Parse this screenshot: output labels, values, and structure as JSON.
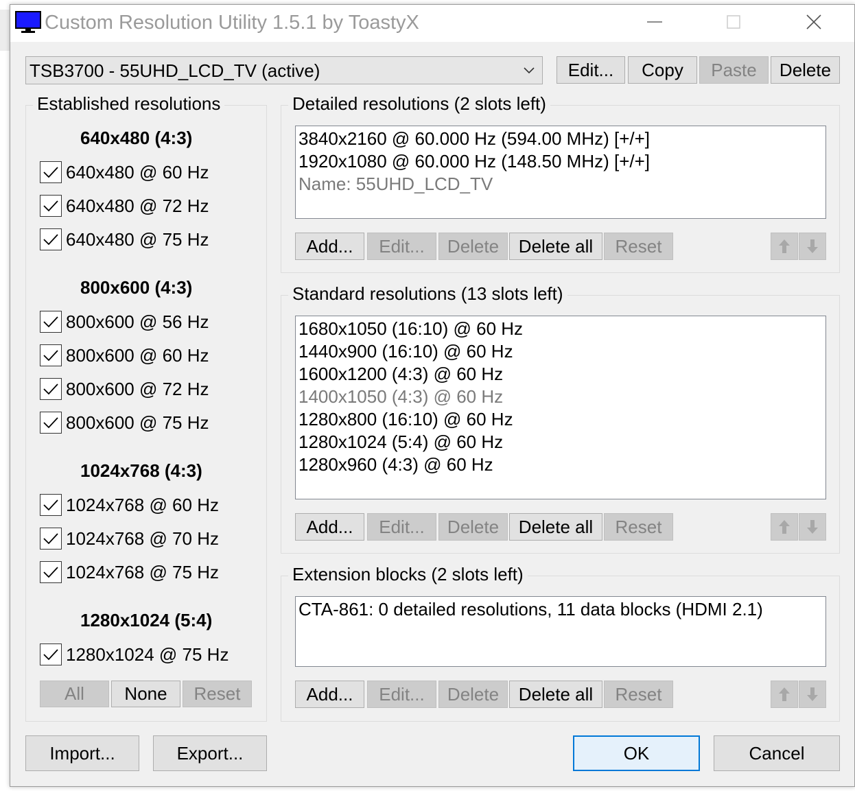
{
  "window": {
    "title": "Custom Resolution Utility 1.5.1 by ToastyX"
  },
  "display": {
    "selected": "TSB3700 - 55UHD_LCD_TV (active)"
  },
  "top_buttons": {
    "edit": "Edit...",
    "copy": "Copy",
    "paste": "Paste",
    "delete": "Delete"
  },
  "established": {
    "title": "Established resolutions",
    "groups": [
      {
        "heading": "640x480 (4:3)",
        "items": [
          "640x480 @ 60 Hz",
          "640x480 @ 72 Hz",
          "640x480 @ 75 Hz"
        ]
      },
      {
        "heading": "800x600 (4:3)",
        "items": [
          "800x600 @ 56 Hz",
          "800x600 @ 60 Hz",
          "800x600 @ 72 Hz",
          "800x600 @ 75 Hz"
        ]
      },
      {
        "heading": "1024x768 (4:3)",
        "items": [
          "1024x768 @ 60 Hz",
          "1024x768 @ 70 Hz",
          "1024x768 @ 75 Hz"
        ]
      },
      {
        "heading": "1280x1024 (5:4)",
        "items": [
          "1280x1024 @ 75 Hz"
        ]
      }
    ],
    "buttons": {
      "all": "All",
      "none": "None",
      "reset": "Reset"
    }
  },
  "detailed": {
    "title": "Detailed resolutions (2 slots left)",
    "items": [
      "3840x2160 @ 60.000 Hz (594.00 MHz) [+/+]",
      "1920x1080 @ 60.000 Hz (148.50 MHz) [+/+]",
      "Name: 55UHD_LCD_TV"
    ]
  },
  "standard": {
    "title": "Standard resolutions (13 slots left)",
    "items": [
      "1680x1050 (16:10) @ 60 Hz",
      "1440x900 (16:10) @ 60 Hz",
      "1600x1200 (4:3) @ 60 Hz",
      "1400x1050 (4:3) @ 60 Hz",
      "1280x800 (16:10) @ 60 Hz",
      "1280x1024 (5:4) @ 60 Hz",
      "1280x960 (4:3) @ 60 Hz"
    ]
  },
  "extension": {
    "title": "Extension blocks (2 slots left)",
    "items": [
      "CTA-861: 0 detailed resolutions, 11 data blocks (HDMI 2.1)"
    ]
  },
  "list_buttons": {
    "add": "Add...",
    "edit": "Edit...",
    "delete": "Delete",
    "delete_all": "Delete all",
    "reset": "Reset"
  },
  "footer": {
    "import": "Import...",
    "export": "Export...",
    "ok": "OK",
    "cancel": "Cancel"
  },
  "colors": {
    "window_bg": "#f0f0f0",
    "accent": "#0078d7",
    "disabled_text": "#838383"
  },
  "icons": [
    "monitor-icon",
    "minimize-icon",
    "maximize-icon",
    "close-icon",
    "chevron-down-icon",
    "checkmark-icon",
    "arrow-up-icon",
    "arrow-down-icon"
  ]
}
